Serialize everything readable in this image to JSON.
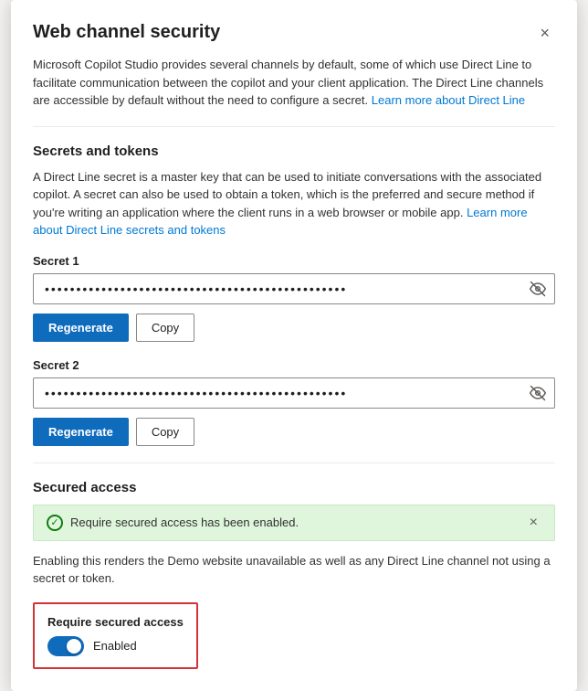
{
  "dialog": {
    "title": "Web channel security",
    "close_label": "×"
  },
  "intro": {
    "text": "Microsoft Copilot Studio provides several channels by default, some of which use Direct Line to facilitate communication between the copilot and your client application. The Direct Line channels are accessible by default without the need to configure a secret.",
    "link_text": "Learn more about Direct Line",
    "link_href": "#"
  },
  "secrets_section": {
    "title": "Secrets and tokens",
    "description": "A Direct Line secret is a master key that can be used to initiate conversations with the associated copilot. A secret can also be used to obtain a token, which is the preferred and secure method if you're writing an application where the client runs in a web browser or mobile app.",
    "link_text": "Learn more about Direct Line secrets and tokens",
    "link_href": "#",
    "secret1": {
      "label": "Secret 1",
      "value": "••••••••••••••••••••••••••••••••••••••••••••••••",
      "regenerate_label": "Regenerate",
      "copy_label": "Copy"
    },
    "secret2": {
      "label": "Secret 2",
      "value": "••••••••••••••••••••••••••••••••••••••••••••••••",
      "regenerate_label": "Regenerate",
      "copy_label": "Copy"
    }
  },
  "secured_access": {
    "title": "Secured access",
    "banner_text": "Require secured access has been enabled.",
    "warning_text": "Enabling this renders the Demo website unavailable as well as any Direct Line channel not using a secret or token.",
    "toggle_label": "Require secured access",
    "toggle_state": "Enabled"
  },
  "icons": {
    "eye": "👁",
    "check": "✓",
    "close": "×"
  }
}
